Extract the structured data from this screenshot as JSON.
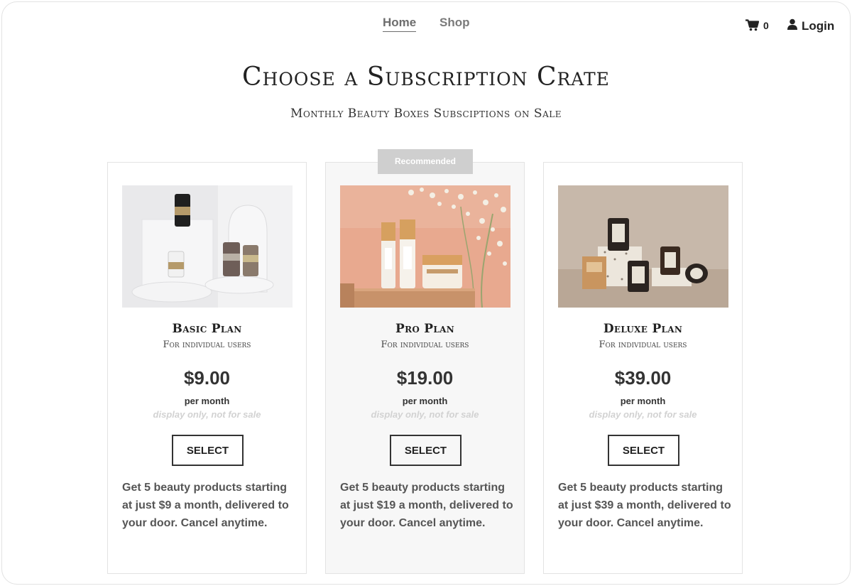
{
  "nav": {
    "links": [
      "Home",
      "Shop"
    ],
    "cart_count": "0",
    "login_label": "Login"
  },
  "header": {
    "title": "Choose a Subscription Crate",
    "subtitle": "Monthly Beauty Boxes Subsciptions on Sale"
  },
  "badge": "Recommended",
  "plans": [
    {
      "name": "Basic Plan",
      "audience": "For individual users",
      "price": "$9.00",
      "period": "per month",
      "note": "display only, not for sale",
      "button": "SELECT",
      "description": "Get 5 beauty products starting at just $9 a month, delivered to your door. Cancel anytime."
    },
    {
      "name": "Pro Plan",
      "audience": "For individual users",
      "price": "$19.00",
      "period": "per month",
      "note": "display only, not for sale",
      "button": "SELECT",
      "description": "Get 5 beauty products starting at just $19 a month, delivered to your door. Cancel anytime."
    },
    {
      "name": "Deluxe Plan",
      "audience": "For individual users",
      "price": "$39.00",
      "period": "per month",
      "note": "display only, not for sale",
      "button": "SELECT",
      "description": "Get 5 beauty products starting at just $39 a month, delivered to your door. Cancel anytime."
    }
  ],
  "icons": [
    "shopping-cart-icon",
    "user-icon"
  ],
  "colors": {
    "badge": "#cfcfcf",
    "featured_card": "#f7f7f7",
    "note_text": "#d2d2d2"
  }
}
